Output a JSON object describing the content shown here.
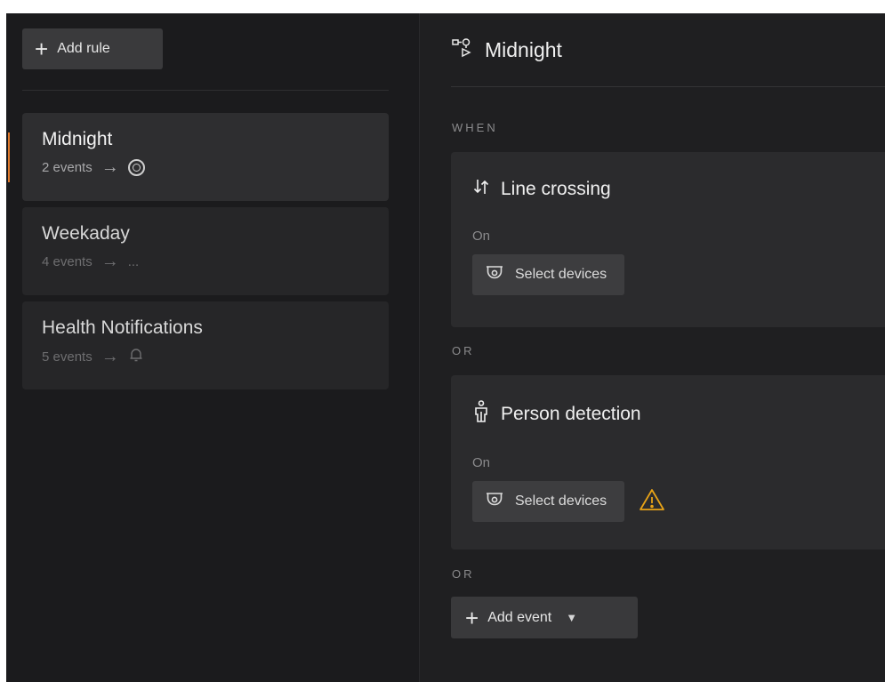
{
  "sidebar": {
    "add_rule_label": "Add rule",
    "rules": [
      {
        "title": "Midnight",
        "events": "2 events",
        "action_icon": "record-ring-icon",
        "active": true
      },
      {
        "title": "Weekaday",
        "events": "4 events",
        "action_text": "..."
      },
      {
        "title": "Health Notifications",
        "events": "5 events",
        "action_icon": "bell-icon"
      }
    ]
  },
  "main": {
    "header_title": "Midnight",
    "header_icon": "rule-flow-icon",
    "when_label": "WHEN",
    "or_label": "OR",
    "events": [
      {
        "title": "Line crossing",
        "icon": "line-crossing-icon",
        "status": "On",
        "select_label": "Select devices",
        "warning": false
      },
      {
        "title": "Person detection",
        "icon": "person-icon",
        "status": "On",
        "select_label": "Select devices",
        "warning": true
      }
    ],
    "add_event_label": "Add event"
  },
  "colors": {
    "accent": "#e07a2c",
    "warning": "#e8a317",
    "background": "#1f1f21"
  }
}
